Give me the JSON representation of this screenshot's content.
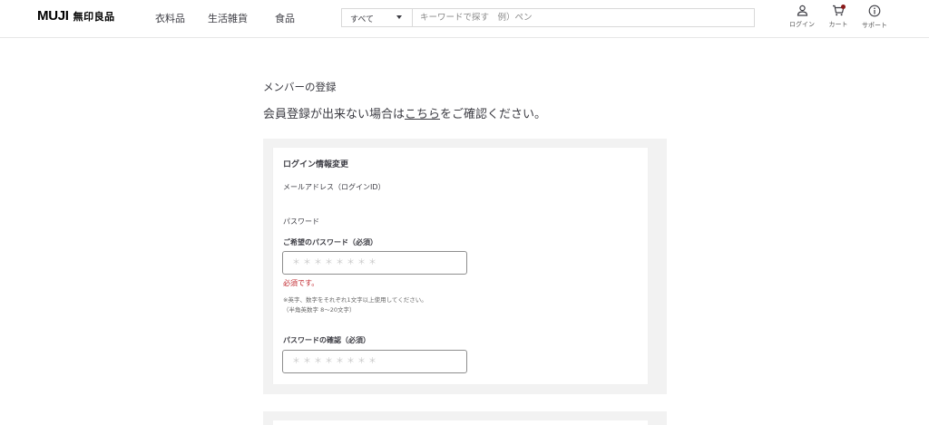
{
  "header": {
    "logo_en": "MUJI",
    "logo_jp": "無印良品",
    "nav": [
      "衣料品",
      "生活雑貨",
      "食品"
    ],
    "search": {
      "category": "すべて",
      "placeholder": "キーワードで探す　例）ペン"
    },
    "icons": {
      "login": {
        "label": "ログイン",
        "icon": "person-icon"
      },
      "cart": {
        "label": "カート",
        "icon": "cart-icon"
      },
      "support": {
        "label": "サポート",
        "icon": "info-icon"
      }
    }
  },
  "main": {
    "page_title": "メンバーの登録",
    "notice_prefix": "会員登録が出来ない場合は",
    "notice_link": "こちら",
    "notice_suffix": "をご確認ください。",
    "form": {
      "section_title": "ログイン情報変更",
      "email_label": "メールアドレス（ログインID）",
      "password_heading": "パスワード",
      "password_label": "ご希望のパスワード（必須）",
      "password_placeholder": "＊＊＊＊＊＊＊＊",
      "error_message": "必須です。",
      "note_line1": "※英字、数字をそれぞれ1文字以上使用してください。",
      "note_line2": "（半角英数字 8～20文字）",
      "confirm_label": "パスワードの確認（必須）",
      "confirm_placeholder": "＊＊＊＊＊＊＊＊"
    }
  },
  "colors": {
    "text": "#3c3c43",
    "error": "#c1272d",
    "panel_bg": "#f2f2f2",
    "cart_badge": "#8b1a1a"
  }
}
